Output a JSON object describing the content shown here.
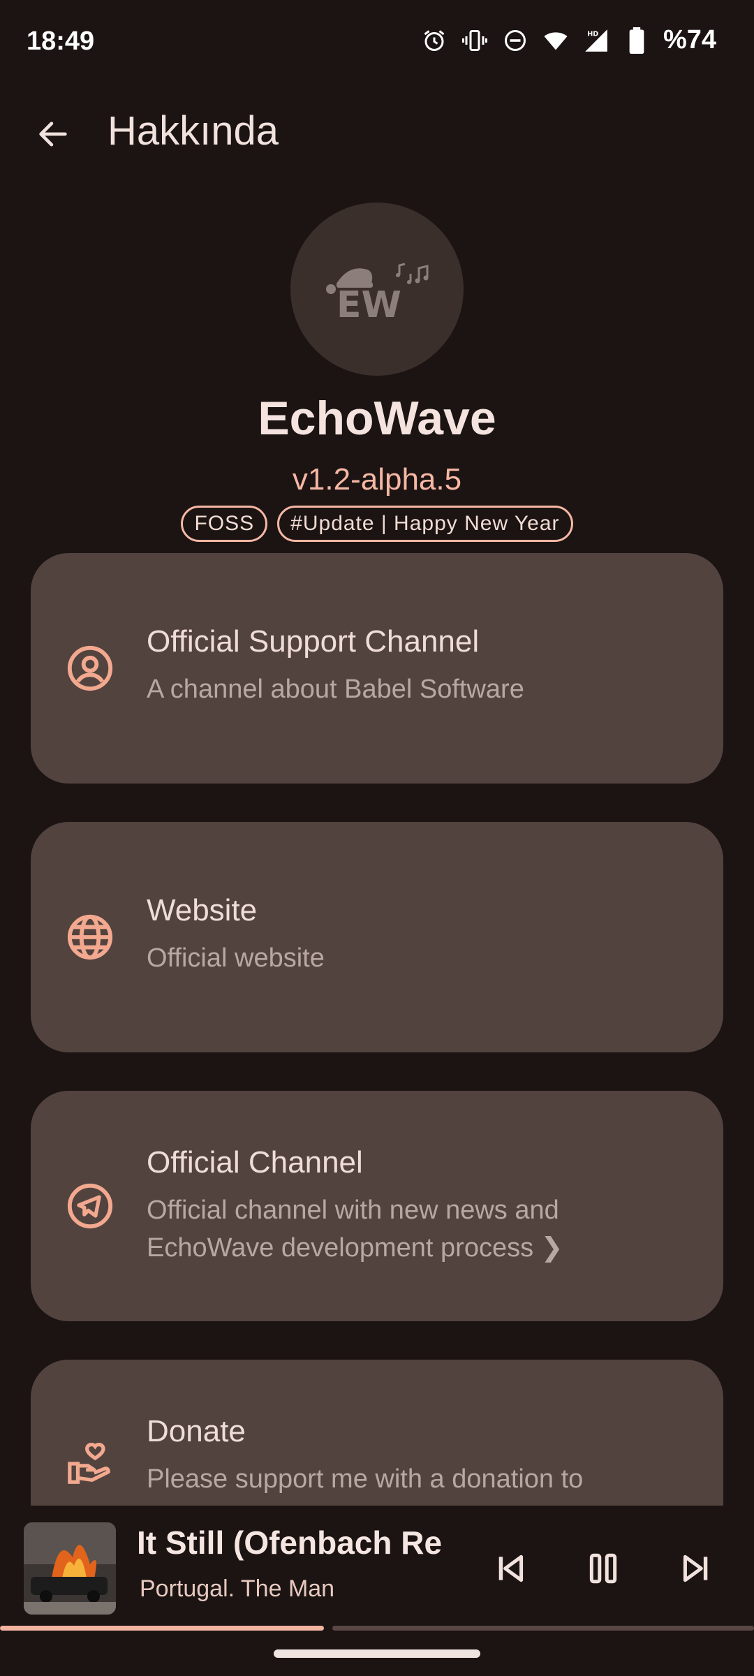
{
  "status": {
    "time": "18:49",
    "battery": "%74",
    "icons": [
      "alarm-icon",
      "vibrate-icon",
      "dnd-icon",
      "wifi-icon",
      "signal-icon",
      "battery-icon"
    ]
  },
  "header": {
    "title": "Hakkında",
    "back_icon": "arrow-back-icon"
  },
  "app": {
    "logo_text": "EW",
    "name": "EchoWave",
    "version": "v1.2-alpha.5",
    "tags": [
      "FOSS",
      "#Update | Happy New Year"
    ]
  },
  "cards": [
    {
      "icon": "account-circle-icon",
      "title": "Official Support Channel",
      "subtitle": "A channel about Babel Software"
    },
    {
      "icon": "globe-icon",
      "title": "Website",
      "subtitle": "Official website"
    },
    {
      "icon": "telegram-icon",
      "title": "Official Channel",
      "subtitle": "Official channel with new news and EchoWave development process ❯"
    },
    {
      "icon": "donate-hand-heart-icon",
      "title": "Donate",
      "subtitle": "Please support me with a donation to"
    }
  ],
  "player": {
    "title": "It Still (Ofenbach Re",
    "artist": "Portugal. The Man",
    "progress": 0.43,
    "controls": [
      "skip-previous-icon",
      "pause-icon",
      "skip-next-icon"
    ]
  },
  "colors": {
    "background": "#1b1413",
    "card": "#52433f",
    "accent": "#f6b7a4"
  }
}
